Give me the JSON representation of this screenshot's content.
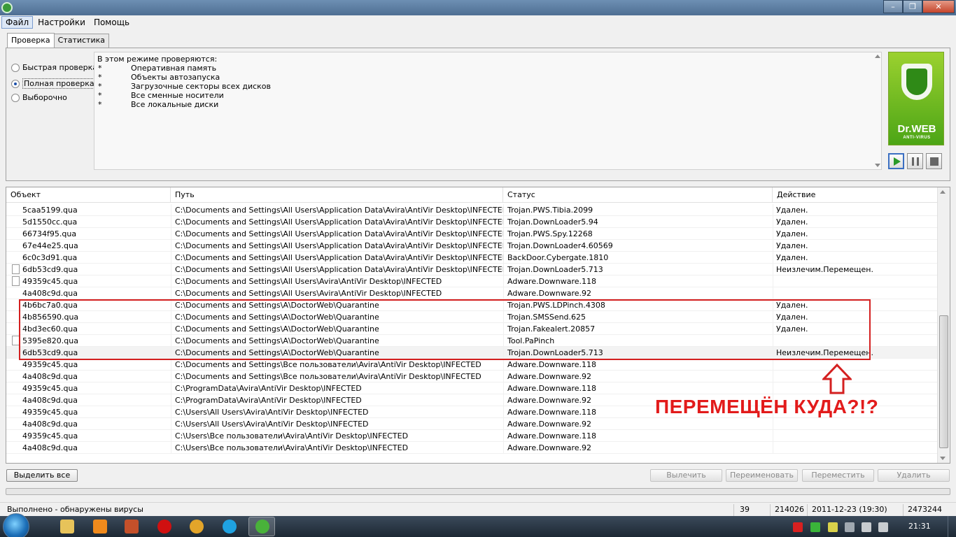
{
  "window": {
    "controls": {
      "minimize": "–",
      "maximize": "❐",
      "close": "✕"
    }
  },
  "menu": {
    "file": "Файл",
    "settings": "Настройки",
    "help": "Помощь"
  },
  "tabs": {
    "scan": "Проверка",
    "stats": "Статистика"
  },
  "scan_modes": {
    "quick": "Быстрая проверка",
    "full": "Полная проверка",
    "custom": "Выборочно",
    "selected": "full"
  },
  "description": {
    "title": "В этом режиме проверяются:",
    "bullet": "*",
    "items": [
      "Оперативная память",
      "Объекты автозапуска",
      "Загрузочные секторы всех дисков",
      "Все сменные носители",
      "Все локальные диски"
    ]
  },
  "logo": {
    "name": "Dr.WEB",
    "sub": "ANTI-VIRUS"
  },
  "table": {
    "headers": [
      "Объект",
      "Путь",
      "Статус",
      "Действие"
    ],
    "rows": [
      {
        "object": "5caa5199.qua",
        "path": "C:\\Documents and Settings\\All Users\\Application Data\\Avira\\AntiVir Desktop\\INFECTED",
        "status": "Trojan.PWS.Tibia.2099",
        "action": "Удален."
      },
      {
        "object": "5d1550cc.qua",
        "path": "C:\\Documents and Settings\\All Users\\Application Data\\Avira\\AntiVir Desktop\\INFECTED",
        "status": "Trojan.DownLoader5.94",
        "action": "Удален."
      },
      {
        "object": "66734f95.qua",
        "path": "C:\\Documents and Settings\\All Users\\Application Data\\Avira\\AntiVir Desktop\\INFECTED",
        "status": "Trojan.PWS.Spy.12268",
        "action": "Удален."
      },
      {
        "object": "67e44e25.qua",
        "path": "C:\\Documents and Settings\\All Users\\Application Data\\Avira\\AntiVir Desktop\\INFECTED",
        "status": "Trojan.DownLoader4.60569",
        "action": "Удален."
      },
      {
        "object": "6c0c3d91.qua",
        "path": "C:\\Documents and Settings\\All Users\\Application Data\\Avira\\AntiVir Desktop\\INFECTED",
        "status": "BackDoor.Cybergate.1810",
        "action": "Удален."
      },
      {
        "object": "6db53cd9.qua",
        "path": "C:\\Documents and Settings\\All Users\\Application Data\\Avira\\AntiVir Desktop\\INFECTED",
        "status": "Trojan.DownLoader5.713",
        "action": "Неизлечим.Перемещен.",
        "icon": true
      },
      {
        "object": "49359c45.qua",
        "path": "C:\\Documents and Settings\\All Users\\Avira\\AntiVir Desktop\\INFECTED",
        "status": "Adware.Downware.118",
        "action": "",
        "icon": true
      },
      {
        "object": "4a408c9d.qua",
        "path": "C:\\Documents and Settings\\All Users\\Avira\\AntiVir Desktop\\INFECTED",
        "status": "Adware.Downware.92",
        "action": ""
      },
      {
        "object": "4b6bc7a0.qua",
        "path": "C:\\Documents and Settings\\A\\DoctorWeb\\Quarantine",
        "status": "Trojan.PWS.LDPinch.4308",
        "action": "Удален."
      },
      {
        "object": "4b856590.qua",
        "path": "C:\\Documents and Settings\\A\\DoctorWeb\\Quarantine",
        "status": "Trojan.SMSSend.625",
        "action": "Удален."
      },
      {
        "object": "4bd3ec60.qua",
        "path": "C:\\Documents and Settings\\A\\DoctorWeb\\Quarantine",
        "status": "Trojan.Fakealert.20857",
        "action": "Удален."
      },
      {
        "object": "5395e820.qua",
        "path": "C:\\Documents and Settings\\A\\DoctorWeb\\Quarantine",
        "status": "Tool.PaPinch",
        "action": "",
        "icon": true
      },
      {
        "object": "6db53cd9.qua",
        "path": "C:\\Documents and Settings\\A\\DoctorWeb\\Quarantine",
        "status": "Trojan.DownLoader5.713",
        "action": "Неизлечим.Перемещен.",
        "selected": true
      },
      {
        "object": "49359c45.qua",
        "path": "C:\\Documents and Settings\\Все пользователи\\Avira\\AntiVir Desktop\\INFECTED",
        "status": "Adware.Downware.118",
        "action": ""
      },
      {
        "object": "4a408c9d.qua",
        "path": "C:\\Documents and Settings\\Все пользователи\\Avira\\AntiVir Desktop\\INFECTED",
        "status": "Adware.Downware.92",
        "action": ""
      },
      {
        "object": "49359c45.qua",
        "path": "C:\\ProgramData\\Avira\\AntiVir Desktop\\INFECTED",
        "status": "Adware.Downware.118",
        "action": ""
      },
      {
        "object": "4a408c9d.qua",
        "path": "C:\\ProgramData\\Avira\\AntiVir Desktop\\INFECTED",
        "status": "Adware.Downware.92",
        "action": ""
      },
      {
        "object": "49359c45.qua",
        "path": "C:\\Users\\All Users\\Avira\\AntiVir Desktop\\INFECTED",
        "status": "Adware.Downware.118",
        "action": ""
      },
      {
        "object": "4a408c9d.qua",
        "path": "C:\\Users\\All Users\\Avira\\AntiVir Desktop\\INFECTED",
        "status": "Adware.Downware.92",
        "action": ""
      },
      {
        "object": "49359c45.qua",
        "path": "C:\\Users\\Все пользователи\\Avira\\AntiVir Desktop\\INFECTED",
        "status": "Adware.Downware.118",
        "action": ""
      },
      {
        "object": "4a408c9d.qua",
        "path": "C:\\Users\\Все пользователи\\Avira\\AntiVir Desktop\\INFECTED",
        "status": "Adware.Downware.92",
        "action": ""
      }
    ]
  },
  "annotation": {
    "text": "ПЕРЕМЕЩЁН КУДА?!?",
    "color": "#e21b1b"
  },
  "buttons": {
    "select_all": "Выделить все",
    "cure": "Вылечить",
    "rename": "Переименовать",
    "move": "Переместить",
    "delete": "Удалить"
  },
  "status": {
    "message": "Выполнено - обнаружены вирусы",
    "count": "39",
    "scanned": "214026",
    "datetime": "2011-12-23 (19:30)",
    "bytes": "2473244"
  },
  "taskbar": {
    "clock": "21:31"
  },
  "colors": {
    "highlight": "#d42020",
    "logo_green": "#4ca516",
    "play_green": "#2a9a2a"
  }
}
